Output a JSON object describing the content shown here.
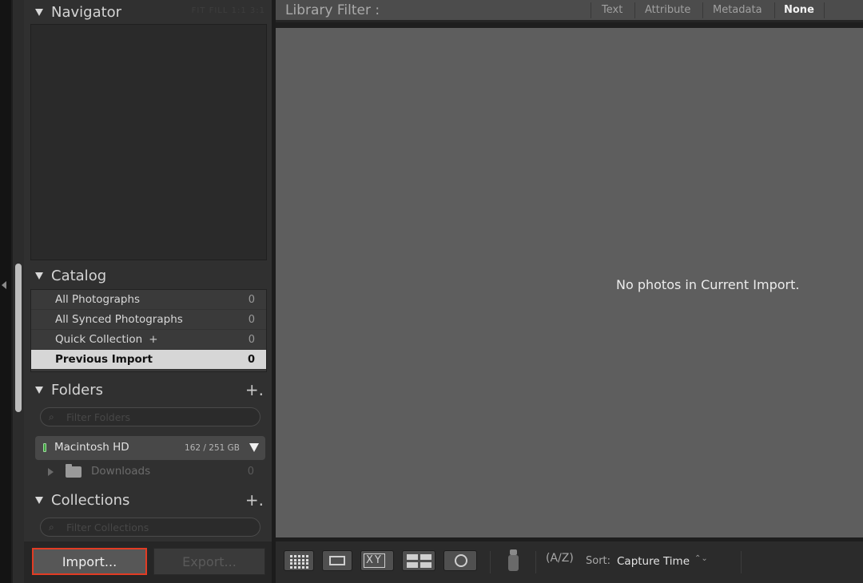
{
  "navigator": {
    "title": "Navigator",
    "zoom_options": "FIT  FILL  1:1  3:1"
  },
  "catalog": {
    "title": "Catalog",
    "items": [
      {
        "label": "All Photographs",
        "count": "0"
      },
      {
        "label": "All Synced Photographs",
        "count": "0"
      },
      {
        "label": "Quick Collection",
        "plus": "+",
        "count": "0"
      },
      {
        "label": "Previous Import",
        "count": "0",
        "selected": true
      }
    ]
  },
  "folders": {
    "title": "Folders",
    "add": "+.",
    "filter_placeholder": "Filter Folders",
    "volume": {
      "name": "Macintosh HD",
      "size": "162 / 251 GB"
    },
    "subfolders": [
      {
        "name": "Downloads",
        "count": "0"
      }
    ]
  },
  "collections": {
    "title": "Collections",
    "add": "+.",
    "filter_placeholder": "Filter Collections"
  },
  "bottom_buttons": {
    "import_label": "Import...",
    "export_label": "Export..."
  },
  "library_filter": {
    "title": "Library Filter :",
    "tabs": [
      "Text",
      "Attribute",
      "Metadata",
      "None"
    ],
    "active_tab": "None"
  },
  "grid": {
    "empty_message": "No photos in Current Import."
  },
  "toolbar": {
    "compare_label": "XY",
    "sort_icon_text": "(A/Z)",
    "sort_label": "Sort:",
    "sort_value": "Capture Time",
    "sort_chevron": "⌃⌄"
  },
  "colors": {
    "import_highlight": "#e23c24",
    "selected_row": "#d6d6d6",
    "volume_led": "#3fa33f"
  }
}
